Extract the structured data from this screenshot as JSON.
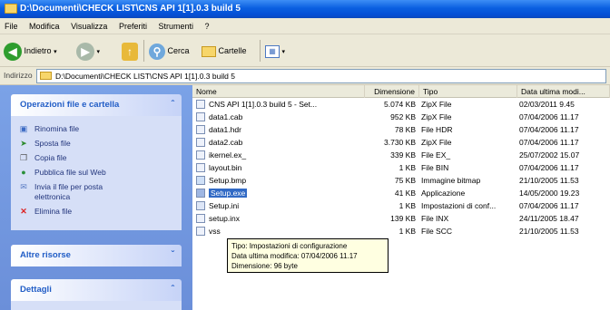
{
  "window": {
    "title": "D:\\Documenti\\CHECK LIST\\CNS API 1[1].0.3 build 5"
  },
  "menu": [
    "File",
    "Modifica",
    "Visualizza",
    "Preferiti",
    "Strumenti",
    "?"
  ],
  "toolbar": {
    "back_label": "Indietro",
    "search_label": "Cerca",
    "folders_label": "Cartelle"
  },
  "address": {
    "label": "Indirizzo",
    "value": "D:\\Documenti\\CHECK LIST\\CNS API 1[1].0.3 build 5"
  },
  "tasks_panel": {
    "title": "Operazioni file e cartella",
    "items": [
      {
        "label": "Rinomina file",
        "icon": "rename-icon"
      },
      {
        "label": "Sposta file",
        "icon": "move-icon"
      },
      {
        "label": "Copia file",
        "icon": "copy-icon"
      },
      {
        "label": "Pubblica file sul Web",
        "icon": "globe-icon"
      },
      {
        "label": "Invia il file per posta",
        "label2": "elettronica",
        "icon": "email-icon"
      },
      {
        "label": "Elimina file",
        "icon": "delete-icon"
      }
    ]
  },
  "other_panel": {
    "title": "Altre risorse"
  },
  "details_panel": {
    "title": "Dettagli"
  },
  "columns": {
    "name": "Nome",
    "size": "Dimensione",
    "type": "Tipo",
    "date": "Data ultima modi..."
  },
  "files": [
    {
      "name": "CNS API 1[1].0.3 build 5 - Set...",
      "size": "5.074 KB",
      "type": "ZipX File",
      "date": "02/03/2011 9.45"
    },
    {
      "name": "data1.cab",
      "size": "952 KB",
      "type": "ZipX File",
      "date": "07/04/2006 11.17"
    },
    {
      "name": "data1.hdr",
      "size": "78 KB",
      "type": "File HDR",
      "date": "07/04/2006 11.17"
    },
    {
      "name": "data2.cab",
      "size": "3.730 KB",
      "type": "ZipX File",
      "date": "07/04/2006 11.17"
    },
    {
      "name": "ikernel.ex_",
      "size": "339 KB",
      "type": "File EX_",
      "date": "25/07/2002 15.07"
    },
    {
      "name": "layout.bin",
      "size": "1 KB",
      "type": "File BIN",
      "date": "07/04/2006 11.17"
    },
    {
      "name": "Setup.bmp",
      "size": "75 KB",
      "type": "Immagine bitmap",
      "date": "21/10/2005 11.53"
    },
    {
      "name": "Setup.exe",
      "size": "41 KB",
      "type": "Applicazione",
      "date": "14/05/2000 19.23"
    },
    {
      "name": "Setup.ini",
      "size": "1 KB",
      "type": "Impostazioni di conf...",
      "date": "07/04/2006 11.17"
    },
    {
      "name": "setup.inx",
      "size": "139 KB",
      "type": "File INX",
      "date": "24/11/2005 18.47"
    },
    {
      "name": "vss",
      "size": "1 KB",
      "type": "File SCC",
      "date": "21/10/2005 11.53"
    }
  ],
  "tooltip": {
    "line1": "Tipo: Impostazioni di configurazione",
    "line2": "Data ultima modifica: 07/04/2006 11.17",
    "line3": "Dimensione: 96 byte"
  }
}
